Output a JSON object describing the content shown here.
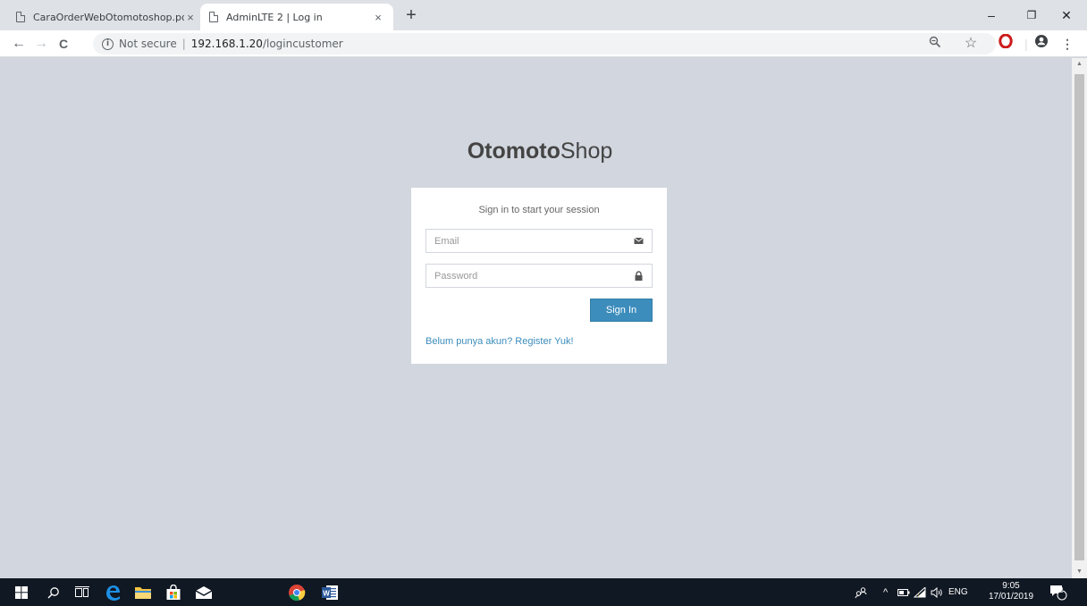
{
  "browser": {
    "tabs": [
      {
        "title": "CaraOrderWebOtomotoshop.pdf",
        "close": "×",
        "active": false
      },
      {
        "title": "AdminLTE 2 | Log in",
        "close": "×",
        "active": true
      }
    ],
    "new_tab": "+",
    "window_controls": {
      "minimize": "–",
      "restore": "❐",
      "close": "✕"
    },
    "nav": {
      "back": "←",
      "forward": "→",
      "reload": "C"
    },
    "security_label": "Not secure",
    "separator": "|",
    "url_host": "192.168.1.20",
    "url_path": "/logincustomer"
  },
  "page": {
    "logo_bold": "Otomoto",
    "logo_rest": "Shop",
    "box_msg": "Sign in to start your session",
    "email_placeholder": "Email",
    "password_placeholder": "Password",
    "signin_label": "Sign In",
    "register_link": "Belum punya akun? Register Yuk!"
  },
  "taskbar": {
    "language": "ENG",
    "time": "9:05",
    "date": "17/01/2019",
    "notification_count": "2"
  },
  "colors": {
    "page_bg": "#d2d6de",
    "primary": "#3c8dbc",
    "taskbar_bg": "#101823",
    "opera_red": "#cc1b1b"
  }
}
